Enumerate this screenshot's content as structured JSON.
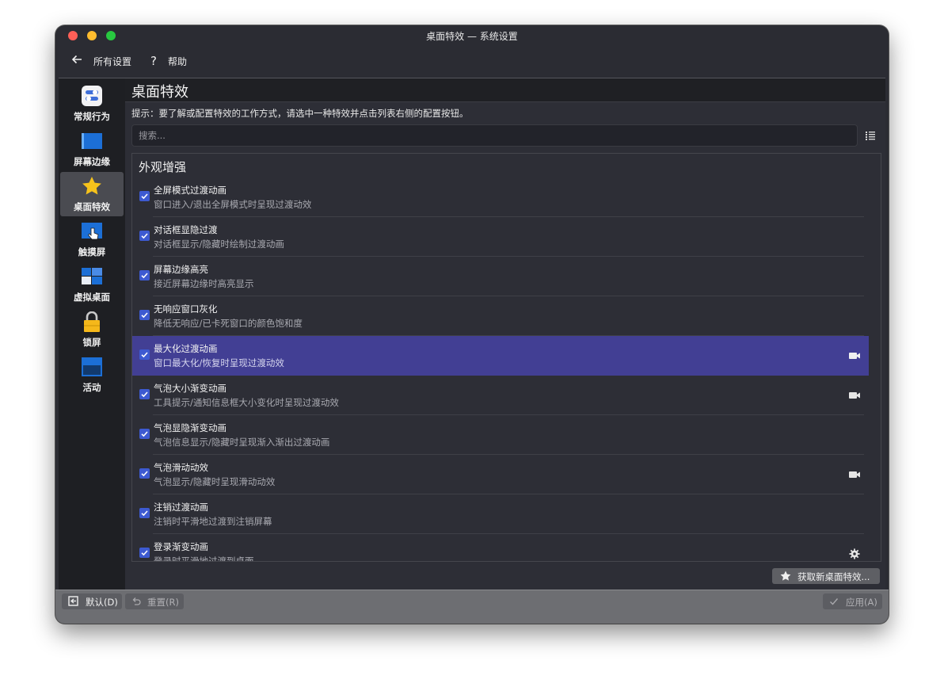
{
  "window": {
    "title": "桌面特效 — 系统设置"
  },
  "toolbar": {
    "back_label": "所有设置",
    "help_label": "帮助"
  },
  "sidebar": {
    "items": [
      {
        "label": "常规行为",
        "icon": "general-behavior-icon"
      },
      {
        "label": "屏幕边缘",
        "icon": "screen-edges-icon"
      },
      {
        "label": "桌面特效",
        "icon": "star-icon",
        "active": true
      },
      {
        "label": "触摸屏",
        "icon": "touchscreen-icon"
      },
      {
        "label": "虚拟桌面",
        "icon": "virtual-desktops-icon"
      },
      {
        "label": "锁屏",
        "icon": "lock-icon"
      },
      {
        "label": "活动",
        "icon": "activities-icon"
      }
    ]
  },
  "main": {
    "title": "桌面特效",
    "hint": "提示：要了解或配置特效的工作方式，请选中一种特效并点击列表右侧的配置按钮。",
    "search_placeholder": "搜索...",
    "category": "外观增强",
    "effects": [
      {
        "title": "全屏模式过渡动画",
        "desc": "窗口进入/退出全屏模式时呈现过渡动效",
        "checked": true
      },
      {
        "title": "对话框显隐过渡",
        "desc": "对话框显示/隐藏时绘制过渡动画",
        "checked": true
      },
      {
        "title": "屏幕边缘高亮",
        "desc": "接近屏幕边缘时高亮显示",
        "checked": true
      },
      {
        "title": "无响应窗口灰化",
        "desc": "降低无响应/已卡死窗口的颜色饱和度",
        "checked": true
      },
      {
        "title": "最大化过渡动画",
        "desc": "窗口最大化/恢复时呈现过渡动效",
        "checked": true,
        "selected": true,
        "button": "video-icon"
      },
      {
        "title": "气泡大小渐变动画",
        "desc": "工具提示/通知信息框大小变化时呈现过渡动效",
        "checked": true,
        "button": "video-icon"
      },
      {
        "title": "气泡显隐渐变动画",
        "desc": "气泡信息显示/隐藏时呈现渐入渐出过渡动画",
        "checked": true
      },
      {
        "title": "气泡滑动动效",
        "desc": "气泡显示/隐藏时呈现滑动动效",
        "checked": true,
        "button": "video-icon"
      },
      {
        "title": "注销过渡动画",
        "desc": "注销时平滑地过渡到注销屏幕",
        "checked": true
      },
      {
        "title": "登录渐变动画",
        "desc": "登录时平滑地过渡到桌面",
        "checked": true,
        "button": "gear-icon"
      }
    ],
    "get_new_label": "获取新桌面特效..."
  },
  "footer": {
    "defaults_label": "默认(D)",
    "reset_label": "重置(R)",
    "apply_label": "应用(A)"
  },
  "colors": {
    "selection": "#423f94",
    "checkbox": "#3d5ad1",
    "window_bg": "#2b2c33"
  }
}
